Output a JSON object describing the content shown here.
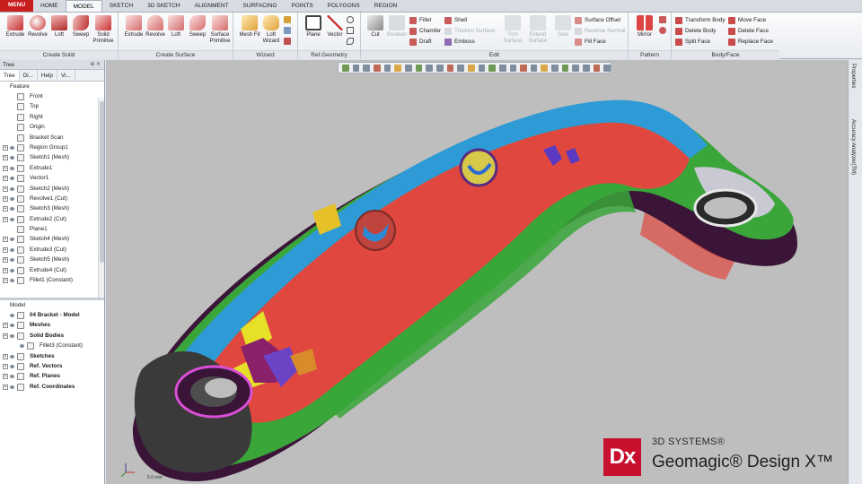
{
  "tabs": [
    "MENU",
    "HOME",
    "MODEL",
    "SKETCH",
    "3D SKETCH",
    "ALIGNMENT",
    "SURFACING",
    "POINTS",
    "POLYGONS",
    "REGION"
  ],
  "active_tab": "MODEL",
  "ribbon": {
    "create_solid": {
      "label": "Create Solid",
      "buttons": [
        "Extrude",
        "Revolve",
        "Loft",
        "Sweep",
        "Solid Primitive"
      ]
    },
    "create_surface": {
      "label": "Create Surface",
      "buttons": [
        "Extrude",
        "Revolve",
        "Loft",
        "Sweep",
        "Surface Primitive"
      ]
    },
    "wizard": {
      "label": "Wizard",
      "buttons": [
        "Mesh Fit",
        "Loft Wizard"
      ]
    },
    "ref_geometry": {
      "label": "Ref.Geometry",
      "buttons": [
        "Plane",
        "Vector"
      ]
    },
    "edit": {
      "label": "Edit",
      "cut": "Cut",
      "boolean": "Boolean",
      "fillet": "Fillet",
      "chamfer": "Chamfer",
      "draft": "Draft",
      "shell": "Shell",
      "thicken_surface": "Thicken Surface",
      "emboss": "Emboss",
      "trim_surface": "Trim Surface",
      "extend_surface": "Extend Surface",
      "sew": "Sew",
      "surface_offset": "Surface Offset",
      "reverse_normal": "Reverse Normal",
      "fill_face": "Fill Face"
    },
    "pattern": {
      "label": "Pattern",
      "mirror": "Mirror"
    },
    "body_face": {
      "label": "Body/Face",
      "transform_body": "Transform Body",
      "delete_body": "Delete Body",
      "split_face": "Split Face",
      "move_face": "Move Face",
      "delete_face": "Delete Face",
      "replace_face": "Replace Face"
    }
  },
  "tree_panel": {
    "title": "Tree",
    "tabs": [
      "Tree",
      "Di...",
      "Help",
      "Vi..."
    ],
    "feature_label": "Feature",
    "features": [
      {
        "name": "Front",
        "icon": "plane-icon",
        "exp": false
      },
      {
        "name": "Top",
        "icon": "plane-icon",
        "exp": false
      },
      {
        "name": "Right",
        "icon": "plane-icon",
        "exp": false
      },
      {
        "name": "Origin",
        "icon": "origin-icon",
        "exp": false
      },
      {
        "name": "Bracket Scan",
        "icon": "scan-icon",
        "exp": false
      },
      {
        "name": "Region Group1",
        "icon": "region-group-icon",
        "exp": true
      },
      {
        "name": "Sketch1 (Mesh)",
        "icon": "sketch-icon",
        "exp": true
      },
      {
        "name": "Extrude1",
        "icon": "extrude-icon",
        "exp": true
      },
      {
        "name": "Vector1",
        "icon": "vector-icon",
        "exp": true
      },
      {
        "name": "Sketch2 (Mesh)",
        "icon": "sketch-icon",
        "exp": true
      },
      {
        "name": "Revolve1 (Cut)",
        "icon": "revolve-icon",
        "exp": true
      },
      {
        "name": "Sketch3 (Mesh)",
        "icon": "sketch-icon",
        "exp": true
      },
      {
        "name": "Extrude2 (Cut)",
        "icon": "extrude-icon",
        "exp": true
      },
      {
        "name": "Plane1",
        "icon": "plane-icon",
        "exp": false
      },
      {
        "name": "Sketch4 (Mesh)",
        "icon": "sketch-icon",
        "exp": true
      },
      {
        "name": "Extrude3 (Cut)",
        "icon": "extrude-icon",
        "exp": true
      },
      {
        "name": "Sketch5 (Mesh)",
        "icon": "sketch-icon",
        "exp": true
      },
      {
        "name": "Extrude4 (Cut)",
        "icon": "extrude-icon",
        "exp": true
      },
      {
        "name": "Fillet1 (Constant)",
        "icon": "fillet-icon",
        "exp": true
      }
    ],
    "model_label": "Model",
    "model_items": [
      {
        "name": "04 Bracket - Model",
        "bold": true,
        "indent": 0,
        "exp": false
      },
      {
        "name": "Meshes",
        "bold": true,
        "indent": 0,
        "exp": true
      },
      {
        "name": "Solid Bodies",
        "bold": true,
        "indent": 0,
        "exp": true
      },
      {
        "name": "Fillet3 (Constant)",
        "bold": false,
        "indent": 1,
        "exp": false
      },
      {
        "name": "Sketches",
        "bold": true,
        "indent": 0,
        "exp": true
      },
      {
        "name": "Ref. Vectors",
        "bold": true,
        "indent": 0,
        "exp": true
      },
      {
        "name": "Ref. Planes",
        "bold": true,
        "indent": 0,
        "exp": true
      },
      {
        "name": "Ref. Coordinates",
        "bold": true,
        "indent": 0,
        "exp": true
      }
    ]
  },
  "right_tabs": [
    "Properties",
    "Accuracy Analyzer(TM)"
  ],
  "brand": {
    "sub": "3D SYSTEMS®",
    "name": "Geomagic® Design X™",
    "logo": "Dx"
  },
  "scale_label": "5.0 mm",
  "colors": {
    "accent_red": "#c81e1e",
    "model_red": "#e0473f",
    "model_blue": "#2e9bd6",
    "model_green": "#3aa63a",
    "model_purple": "#4a1742",
    "viewport_bg": "#bebebe"
  }
}
